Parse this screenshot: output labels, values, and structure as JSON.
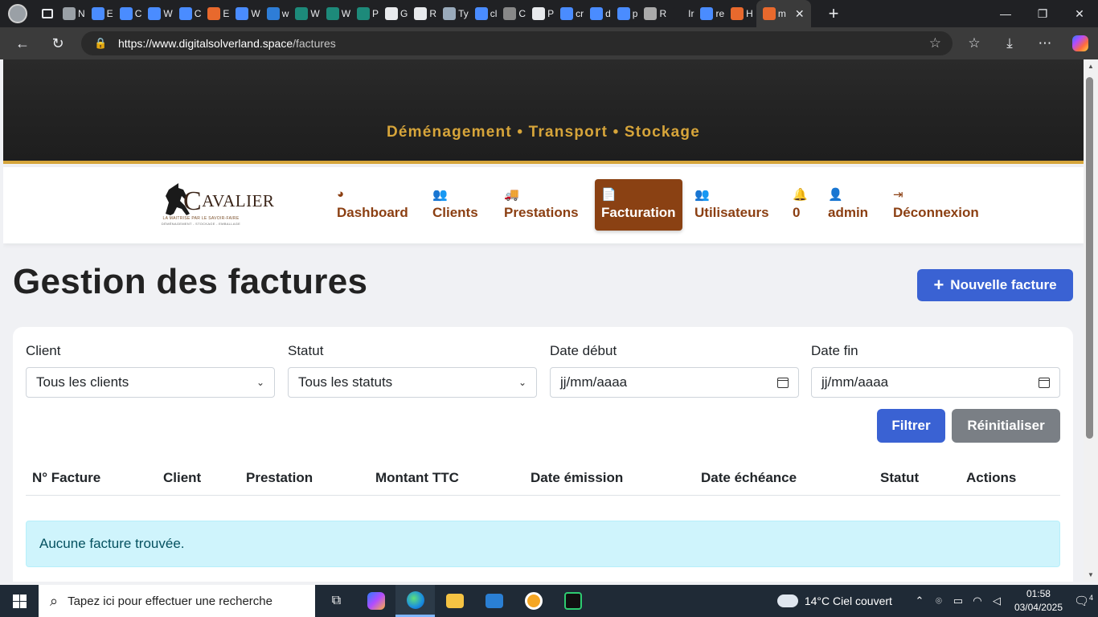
{
  "browser": {
    "tabs": [
      {
        "icon": "globe-icon",
        "label": "N",
        "color": "#9aa0a6"
      },
      {
        "icon": "slash-icon",
        "label": "E",
        "color": "#4a8cff"
      },
      {
        "icon": "slash-icon",
        "label": "C",
        "color": "#4a8cff"
      },
      {
        "icon": "slash-icon",
        "label": "W",
        "color": "#4a8cff"
      },
      {
        "icon": "slash-icon",
        "label": "C",
        "color": "#4a8cff"
      },
      {
        "icon": "horse-icon",
        "label": "E",
        "color": "#e8692d"
      },
      {
        "icon": "slash-icon",
        "label": "W",
        "color": "#4a8cff"
      },
      {
        "icon": "bing-icon",
        "label": "w",
        "color": "#2e7dd7"
      },
      {
        "icon": "wp-icon",
        "label": "W",
        "color": "#1d8a7a"
      },
      {
        "icon": "wp-icon",
        "label": "W",
        "color": "#1d8a7a"
      },
      {
        "icon": "wp-icon",
        "label": "P",
        "color": "#1d8a7a"
      },
      {
        "icon": "github-icon",
        "label": "G",
        "color": "#e8eaed"
      },
      {
        "icon": "github-icon",
        "label": "R",
        "color": "#e8eaed"
      },
      {
        "icon": "terminal-icon",
        "label": "Ty",
        "color": "#9ab"
      },
      {
        "icon": "search-icon",
        "label": "cl",
        "color": "#4a8cff"
      },
      {
        "icon": "ai-icon",
        "label": "C",
        "color": "#888"
      },
      {
        "icon": "openai-icon",
        "label": "P",
        "color": "#e8eaed"
      },
      {
        "icon": "search-icon",
        "label": "cr",
        "color": "#4a8cff"
      },
      {
        "icon": "search-icon",
        "label": "d",
        "color": "#4a8cff"
      },
      {
        "icon": "search-icon",
        "label": "p",
        "color": "#4a8cff"
      },
      {
        "icon": "image-icon",
        "label": "R",
        "color": "#aaa"
      },
      {
        "icon": "blank-icon",
        "label": "Ir",
        "color": "#202124"
      },
      {
        "icon": "search-icon",
        "label": "re",
        "color": "#4a8cff"
      },
      {
        "icon": "horse-icon",
        "label": "H",
        "color": "#e8692d"
      }
    ],
    "active_tab": {
      "icon": "horse-icon",
      "label": "m",
      "close": "✕"
    },
    "new_tab": "+",
    "url_host": "https://www.digitalsolverland.space",
    "url_path": "/factures",
    "window": {
      "minimize": "—",
      "maximize": "❐",
      "close": "✕"
    }
  },
  "site": {
    "tagline": "Déménagement • Transport • Stockage",
    "logo": {
      "brand_initial": "C",
      "brand_rest": "AVALIER",
      "sub1": "LA MAITRISE PAR LE SAVOIR-FAIRE",
      "sub2": "DÉMÉNAGEMENT - STOCKAGE - EMBALLAGE"
    },
    "nav": [
      {
        "name": "dashboard",
        "label": "Dashboard",
        "icon": "◕"
      },
      {
        "name": "clients",
        "label": "Clients",
        "icon": "👥"
      },
      {
        "name": "prestations",
        "label": "Prestations",
        "icon": "🚚"
      },
      {
        "name": "facturation",
        "label": "Facturation",
        "icon": "📄",
        "active": true
      },
      {
        "name": "utilisateurs",
        "label": "Utilisateurs",
        "icon": "👥"
      },
      {
        "name": "notifications",
        "label": "0",
        "icon": "🔔"
      },
      {
        "name": "admin",
        "label": "admin",
        "icon": "👤"
      },
      {
        "name": "deconnexion",
        "label": "Déconnexion",
        "icon": "⇥"
      }
    ]
  },
  "page": {
    "title": "Gestion des factures",
    "new_button": "Nouvelle facture",
    "filters": {
      "client": {
        "label": "Client",
        "value": "Tous les clients"
      },
      "statut": {
        "label": "Statut",
        "value": "Tous les statuts"
      },
      "date_debut": {
        "label": "Date début",
        "placeholder": "jj/mm/aaaa"
      },
      "date_fin": {
        "label": "Date fin",
        "placeholder": "jj/mm/aaaa"
      }
    },
    "filter_button": "Filtrer",
    "reset_button": "Réinitialiser",
    "table": {
      "columns": [
        "N° Facture",
        "Client",
        "Prestation",
        "Montant TTC",
        "Date émission",
        "Date échéance",
        "Statut",
        "Actions"
      ]
    },
    "empty_message": "Aucune facture trouvée."
  },
  "taskbar": {
    "search_placeholder": "Tapez ici pour effectuer une recherche",
    "weather": "14°C  Ciel couvert",
    "time": "01:58",
    "date": "03/04/2025",
    "notifications_count": "4"
  },
  "colors": {
    "brand_brown": "#8a4113",
    "tagline_gold": "#d7a53a",
    "primary_blue": "#3a62d3",
    "secondary_gray": "#7a7f85",
    "info_bg": "#cff4fc"
  }
}
